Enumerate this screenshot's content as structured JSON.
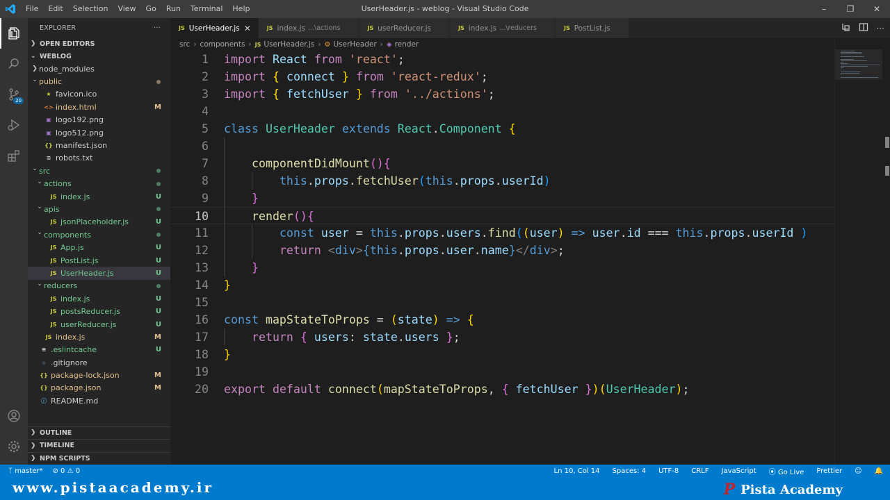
{
  "window": {
    "title": "UserHeader.js - weblog - Visual Studio Code",
    "menu": [
      "File",
      "Edit",
      "Selection",
      "View",
      "Go",
      "Run",
      "Terminal",
      "Help"
    ]
  },
  "activity": {
    "scm_badge": "20"
  },
  "sidebar": {
    "explorer_title": "EXPLORER",
    "more": "···",
    "open_editors": "OPEN EDITORS",
    "project": "WEBLOG",
    "tree": [
      {
        "label": "node_modules",
        "depth": 1,
        "type": "folder",
        "open": false,
        "status": ""
      },
      {
        "label": "public",
        "depth": 1,
        "type": "folder",
        "open": true,
        "status": "dot-mod"
      },
      {
        "label": "favicon.ico",
        "depth": 2,
        "type": "star",
        "status": ""
      },
      {
        "label": "index.html",
        "depth": 2,
        "type": "html",
        "status": "M"
      },
      {
        "label": "logo192.png",
        "depth": 2,
        "type": "img",
        "status": ""
      },
      {
        "label": "logo512.png",
        "depth": 2,
        "type": "img",
        "status": ""
      },
      {
        "label": "manifest.json",
        "depth": 2,
        "type": "json",
        "status": ""
      },
      {
        "label": "robots.txt",
        "depth": 2,
        "type": "txt",
        "status": ""
      },
      {
        "label": "src",
        "depth": 1,
        "type": "folder",
        "open": true,
        "status": "dot"
      },
      {
        "label": "actions",
        "depth": 2,
        "type": "folder",
        "open": true,
        "status": "dot"
      },
      {
        "label": "index.js",
        "depth": 3,
        "type": "js",
        "status": "U"
      },
      {
        "label": "apis",
        "depth": 2,
        "type": "folder",
        "open": true,
        "status": "dot"
      },
      {
        "label": "jsonPlaceholder.js",
        "depth": 3,
        "type": "js",
        "status": "U"
      },
      {
        "label": "components",
        "depth": 2,
        "type": "folder",
        "open": true,
        "status": "dot"
      },
      {
        "label": "App.js",
        "depth": 3,
        "type": "js",
        "status": "U"
      },
      {
        "label": "PostList.js",
        "depth": 3,
        "type": "js",
        "status": "U"
      },
      {
        "label": "UserHeader.js",
        "depth": 3,
        "type": "js",
        "status": "U",
        "selected": true
      },
      {
        "label": "reducers",
        "depth": 2,
        "type": "folder",
        "open": true,
        "status": "dot"
      },
      {
        "label": "index.js",
        "depth": 3,
        "type": "js",
        "status": "U"
      },
      {
        "label": "postsReducer.js",
        "depth": 3,
        "type": "js",
        "status": "U"
      },
      {
        "label": "userReducer.js",
        "depth": 3,
        "type": "js",
        "status": "U"
      },
      {
        "label": "index.js",
        "depth": 2,
        "type": "js",
        "status": "M"
      },
      {
        "label": ".eslintcache",
        "depth": 1,
        "type": "cache",
        "status": "U"
      },
      {
        "label": ".gitignore",
        "depth": 1,
        "type": "git",
        "status": ""
      },
      {
        "label": "package-lock.json",
        "depth": 1,
        "type": "json",
        "status": "M"
      },
      {
        "label": "package.json",
        "depth": 1,
        "type": "json",
        "status": "M"
      },
      {
        "label": "README.md",
        "depth": 1,
        "type": "md",
        "status": ""
      }
    ],
    "outline": "OUTLINE",
    "timeline": "TIMELINE",
    "npm_scripts": "NPM SCRIPTS"
  },
  "tabs": [
    {
      "label": "UserHeader.js",
      "desc": "",
      "active": true
    },
    {
      "label": "index.js",
      "desc": "...\\actions",
      "active": false
    },
    {
      "label": "userReducer.js",
      "desc": "",
      "active": false
    },
    {
      "label": "index.js",
      "desc": "...\\reducers",
      "active": false
    },
    {
      "label": "PostList.js",
      "desc": "",
      "active": false
    }
  ],
  "breadcrumb": {
    "items": [
      "src",
      "components",
      "UserHeader.js",
      "UserHeader",
      "render"
    ]
  },
  "editor": {
    "current_line": 10,
    "lines": [
      [
        [
          "k-kw",
          "import"
        ],
        [
          "k-pl",
          " "
        ],
        [
          "k-var",
          "React"
        ],
        [
          "k-pl",
          " "
        ],
        [
          "k-kw",
          "from"
        ],
        [
          "k-pl",
          " "
        ],
        [
          "k-str",
          "'react'"
        ],
        [
          "k-pl",
          ";"
        ]
      ],
      [
        [
          "k-kw",
          "import"
        ],
        [
          "k-pl",
          " "
        ],
        [
          "k-b1",
          "{"
        ],
        [
          "k-pl",
          " "
        ],
        [
          "k-var",
          "connect"
        ],
        [
          "k-pl",
          " "
        ],
        [
          "k-b1",
          "}"
        ],
        [
          "k-pl",
          " "
        ],
        [
          "k-kw",
          "from"
        ],
        [
          "k-pl",
          " "
        ],
        [
          "k-str",
          "'react-redux'"
        ],
        [
          "k-pl",
          ";"
        ]
      ],
      [
        [
          "k-kw",
          "import"
        ],
        [
          "k-pl",
          " "
        ],
        [
          "k-b1",
          "{"
        ],
        [
          "k-pl",
          " "
        ],
        [
          "k-var",
          "fetchUser"
        ],
        [
          "k-pl",
          " "
        ],
        [
          "k-b1",
          "}"
        ],
        [
          "k-pl",
          " "
        ],
        [
          "k-kw",
          "from"
        ],
        [
          "k-pl",
          " "
        ],
        [
          "k-str",
          "'../actions'"
        ],
        [
          "k-pl",
          ";"
        ]
      ],
      [],
      [
        [
          "k-st",
          "class"
        ],
        [
          "k-pl",
          " "
        ],
        [
          "k-cls",
          "UserHeader"
        ],
        [
          "k-pl",
          " "
        ],
        [
          "k-st",
          "extends"
        ],
        [
          "k-pl",
          " "
        ],
        [
          "k-cls",
          "React"
        ],
        [
          "k-pl",
          "."
        ],
        [
          "k-cls",
          "Component"
        ],
        [
          "k-pl",
          " "
        ],
        [
          "k-b1",
          "{"
        ]
      ],
      [],
      [
        [
          "k-pl",
          "    "
        ],
        [
          "k-fn",
          "componentDidMount"
        ],
        [
          "k-b2",
          "()"
        ],
        [
          "k-b2",
          "{"
        ]
      ],
      [
        [
          "k-pl",
          "        "
        ],
        [
          "k-st",
          "this"
        ],
        [
          "k-pl",
          "."
        ],
        [
          "k-var",
          "props"
        ],
        [
          "k-pl",
          "."
        ],
        [
          "k-fn",
          "fetchUser"
        ],
        [
          "k-b3",
          "("
        ],
        [
          "k-st",
          "this"
        ],
        [
          "k-pl",
          "."
        ],
        [
          "k-var",
          "props"
        ],
        [
          "k-pl",
          "."
        ],
        [
          "k-var",
          "userId"
        ],
        [
          "k-b3",
          ")"
        ]
      ],
      [
        [
          "k-pl",
          "    "
        ],
        [
          "k-b2",
          "}"
        ]
      ],
      [
        [
          "k-pl",
          "    "
        ],
        [
          "k-fn",
          "render"
        ],
        [
          "k-b2",
          "()"
        ],
        [
          "k-b2",
          "{"
        ]
      ],
      [
        [
          "k-pl",
          "        "
        ],
        [
          "k-st",
          "const"
        ],
        [
          "k-pl",
          " "
        ],
        [
          "k-var",
          "user"
        ],
        [
          "k-pl",
          " = "
        ],
        [
          "k-st",
          "this"
        ],
        [
          "k-pl",
          "."
        ],
        [
          "k-var",
          "props"
        ],
        [
          "k-pl",
          "."
        ],
        [
          "k-var",
          "users"
        ],
        [
          "k-pl",
          "."
        ],
        [
          "k-fn",
          "find"
        ],
        [
          "k-b3",
          "("
        ],
        [
          "k-b1",
          "("
        ],
        [
          "k-var",
          "user"
        ],
        [
          "k-b1",
          ")"
        ],
        [
          "k-pl",
          " "
        ],
        [
          "k-st",
          "=>"
        ],
        [
          "k-pl",
          " "
        ],
        [
          "k-var",
          "user"
        ],
        [
          "k-pl",
          "."
        ],
        [
          "k-var",
          "id"
        ],
        [
          "k-pl",
          " === "
        ],
        [
          "k-st",
          "this"
        ],
        [
          "k-pl",
          "."
        ],
        [
          "k-var",
          "props"
        ],
        [
          "k-pl",
          "."
        ],
        [
          "k-var",
          "userId"
        ],
        [
          "k-pl",
          " "
        ],
        [
          "k-b3",
          ")"
        ]
      ],
      [
        [
          "k-pl",
          "        "
        ],
        [
          "k-kw",
          "return"
        ],
        [
          "k-pl",
          " "
        ],
        [
          "k-tag",
          "<"
        ],
        [
          "k-st",
          "div"
        ],
        [
          "k-tag",
          ">"
        ],
        [
          "k-st",
          "{"
        ],
        [
          "k-st",
          "this"
        ],
        [
          "k-pl",
          "."
        ],
        [
          "k-var",
          "props"
        ],
        [
          "k-pl",
          "."
        ],
        [
          "k-var",
          "user"
        ],
        [
          "k-pl",
          "."
        ],
        [
          "k-var",
          "name"
        ],
        [
          "k-st",
          "}"
        ],
        [
          "k-tag",
          "</"
        ],
        [
          "k-st",
          "div"
        ],
        [
          "k-tag",
          ">"
        ],
        [
          "k-pl",
          ";"
        ]
      ],
      [
        [
          "k-pl",
          "    "
        ],
        [
          "k-b2",
          "}"
        ]
      ],
      [
        [
          "k-b1",
          "}"
        ]
      ],
      [],
      [
        [
          "k-st",
          "const"
        ],
        [
          "k-pl",
          " "
        ],
        [
          "k-fn",
          "mapStateToProps"
        ],
        [
          "k-pl",
          " = "
        ],
        [
          "k-b1",
          "("
        ],
        [
          "k-var",
          "state"
        ],
        [
          "k-b1",
          ")"
        ],
        [
          "k-pl",
          " "
        ],
        [
          "k-st",
          "=>"
        ],
        [
          "k-pl",
          " "
        ],
        [
          "k-b1",
          "{"
        ]
      ],
      [
        [
          "k-pl",
          "    "
        ],
        [
          "k-kw",
          "return"
        ],
        [
          "k-pl",
          " "
        ],
        [
          "k-b2",
          "{"
        ],
        [
          "k-pl",
          " "
        ],
        [
          "k-var",
          "users"
        ],
        [
          "k-pl",
          ": "
        ],
        [
          "k-var",
          "state"
        ],
        [
          "k-pl",
          "."
        ],
        [
          "k-var",
          "users"
        ],
        [
          "k-pl",
          " "
        ],
        [
          "k-b2",
          "}"
        ],
        [
          "k-pl",
          ";"
        ]
      ],
      [
        [
          "k-b1",
          "}"
        ]
      ],
      [],
      [
        [
          "k-kw",
          "export"
        ],
        [
          "k-pl",
          " "
        ],
        [
          "k-kw",
          "default"
        ],
        [
          "k-pl",
          " "
        ],
        [
          "k-fn",
          "connect"
        ],
        [
          "k-b1",
          "("
        ],
        [
          "k-fn",
          "mapStateToProps"
        ],
        [
          "k-pl",
          ", "
        ],
        [
          "k-b2",
          "{"
        ],
        [
          "k-pl",
          " "
        ],
        [
          "k-var",
          "fetchUser"
        ],
        [
          "k-pl",
          " "
        ],
        [
          "k-b2",
          "}"
        ],
        [
          "k-b1",
          ")"
        ],
        [
          "k-b1",
          "("
        ],
        [
          "k-cls",
          "UserHeader"
        ],
        [
          "k-b1",
          ")"
        ],
        [
          "k-pl",
          ";"
        ]
      ]
    ]
  },
  "statusbar": {
    "branch": "master*",
    "problems": "0",
    "warnings": "0",
    "position": "Ln 10, Col 14",
    "spaces": "Spaces: 4",
    "encoding": "UTF-8",
    "eol": "CRLF",
    "language": "JavaScript",
    "golive": "Go Live",
    "prettier": "Prettier"
  },
  "watermark": {
    "url": "www.pistaacademy.ir",
    "brand": "Pista Academy"
  },
  "colors": {
    "accent": "#007acc",
    "modified": "#e2c08d",
    "untracked": "#73c991"
  }
}
